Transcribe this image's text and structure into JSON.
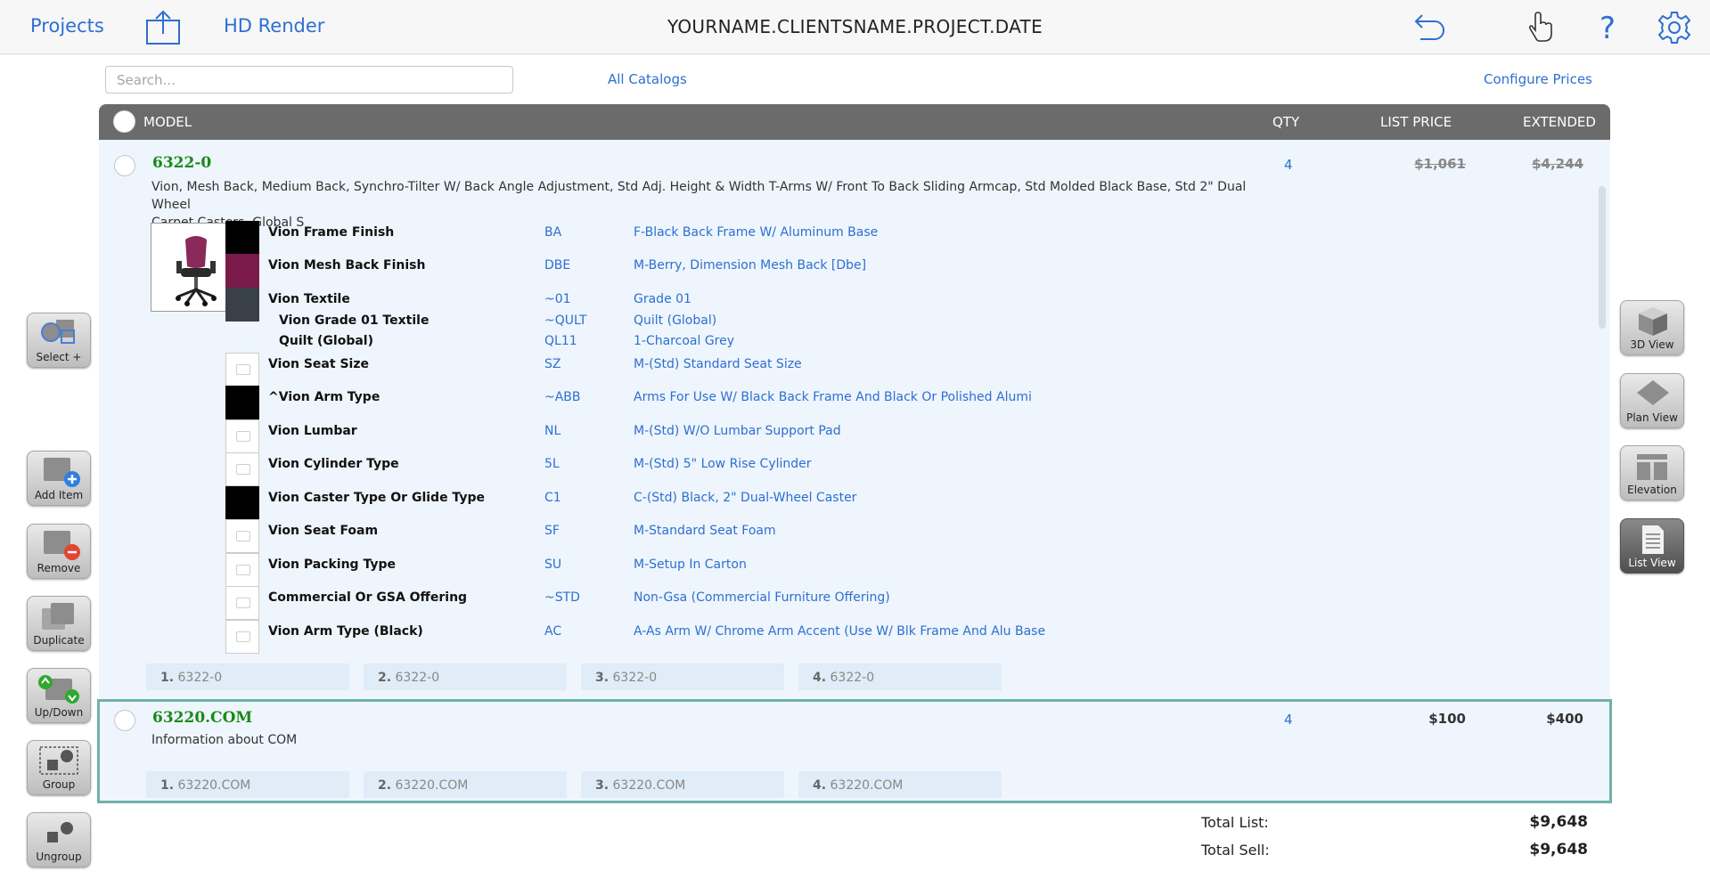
{
  "topbar": {
    "projects_label": "Projects",
    "render_label": "HD Render",
    "title": "YOURNAME.CLIENTSNAME.PROJECT.DATE"
  },
  "search": {
    "placeholder": "Search...",
    "catalogs_label": "All Catalogs",
    "configure_label": "Configure Prices"
  },
  "table": {
    "col_model": "MODEL",
    "col_qty": "QTY",
    "col_list": "LIST PRICE",
    "col_extended": "EXTENDED"
  },
  "items": [
    {
      "model": "6322-0",
      "desc_line1": "Vion, Mesh Back, Medium Back, Synchro-Tilter W/ Back Angle Adjustment, Std Adj. Height & Width T-Arms W/ Front To Back Sliding Armcap, Std Molded Black Base, Std 2\" Dual Wheel",
      "desc_line2": "Carpet Casters, Global S",
      "qty": "4",
      "list_price": "$1,061",
      "extended": "$4,244",
      "options": [
        {
          "name": "Vion Frame Finish",
          "code": "BA",
          "value": "F-Black Back Frame W/ Aluminum Base"
        },
        {
          "name": "Vion Mesh Back Finish",
          "code": "DBE",
          "value": "M-Berry, Dimension Mesh Back [Dbe]"
        },
        {
          "name": "Vion Textile",
          "code": "~01",
          "value": "Grade 01"
        },
        {
          "name": "Vion Grade 01 Textile",
          "code": "~QULT",
          "value": "Quilt (Global)"
        },
        {
          "name": "Quilt (Global)",
          "code": "QL11",
          "value": "1-Charcoal Grey"
        },
        {
          "name": "Vion Seat Size",
          "code": "SZ",
          "value": "M-(Std) Standard Seat Size"
        },
        {
          "name": "^Vion Arm Type",
          "code": "~ABB",
          "value": "Arms For Use W/ Black Back Frame And Black Or Polished Alumi"
        },
        {
          "name": "Vion Lumbar",
          "code": "NL",
          "value": "M-(Std) W/O Lumbar Support Pad"
        },
        {
          "name": "Vion Cylinder Type",
          "code": "5L",
          "value": "M-(Std) 5\" Low Rise Cylinder"
        },
        {
          "name": "Vion Caster Type Or Glide Type",
          "code": "C1",
          "value": "C-(Std) Black, 2\" Dual-Wheel Caster"
        },
        {
          "name": "Vion Seat Foam",
          "code": "SF",
          "value": "M-Standard Seat Foam"
        },
        {
          "name": "Vion Packing Type",
          "code": "SU",
          "value": "M-Setup In Carton"
        },
        {
          "name": "Commercial Or GSA Offering",
          "code": "~STD",
          "value": "Non-Gsa (Commercial Furniture Offering)"
        },
        {
          "name": "Vion Arm Type (Black)",
          "code": "AC",
          "value": "A-As Arm W/ Chrome Arm Accent (Use W/ Blk Frame And Alu Base"
        }
      ],
      "subs": [
        {
          "num": "1.",
          "label": "6322-0"
        },
        {
          "num": "2.",
          "label": "6322-0"
        },
        {
          "num": "3.",
          "label": "6322-0"
        },
        {
          "num": "4.",
          "label": "6322-0"
        }
      ]
    },
    {
      "model": "63220.COM",
      "desc_line1": "Information about COM",
      "qty": "4",
      "list_price": "$100",
      "extended": "$400",
      "subs": [
        {
          "num": "1.",
          "label": "63220.COM"
        },
        {
          "num": "2.",
          "label": "63220.COM"
        },
        {
          "num": "3.",
          "label": "63220.COM"
        },
        {
          "num": "4.",
          "label": "63220.COM"
        }
      ]
    }
  ],
  "totals": {
    "list_label": "Total List:",
    "list_value": "$9,648",
    "sell_label": "Total Sell:",
    "sell_value": "$9,648"
  },
  "left_tools": [
    {
      "label": "Select +",
      "icon": "select-plus-icon"
    },
    {
      "label": "Add Item",
      "icon": "add-item-icon"
    },
    {
      "label": "Remove",
      "icon": "remove-icon"
    },
    {
      "label": "Duplicate",
      "icon": "duplicate-icon"
    },
    {
      "label": "Up/Down",
      "icon": "up-down-icon"
    },
    {
      "label": "Group",
      "icon": "group-icon"
    },
    {
      "label": "Ungroup",
      "icon": "ungroup-icon"
    }
  ],
  "right_tools": [
    {
      "label": "3D View",
      "icon": "cube-icon"
    },
    {
      "label": "Plan View",
      "icon": "plan-view-icon"
    },
    {
      "label": "Elevation",
      "icon": "elevation-icon"
    },
    {
      "label": "List View",
      "icon": "list-view-icon"
    }
  ]
}
